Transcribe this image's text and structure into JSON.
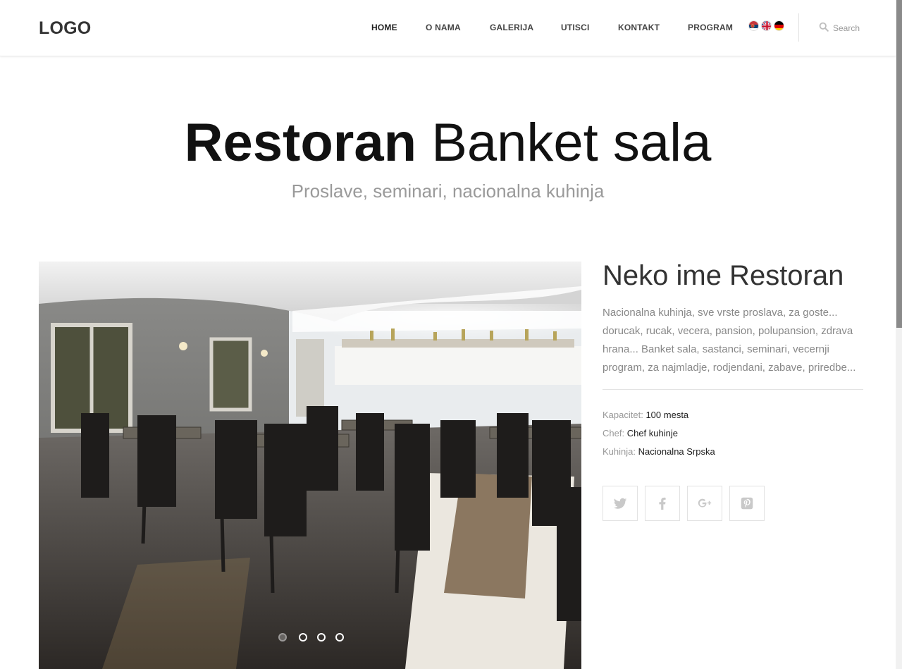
{
  "header": {
    "logo": "LOGO",
    "nav": [
      {
        "label": "HOME",
        "active": true
      },
      {
        "label": "O NAMA",
        "active": false
      },
      {
        "label": "GALERIJA",
        "active": false
      },
      {
        "label": "UTISCI",
        "active": false
      },
      {
        "label": "KONTAKT",
        "active": false
      },
      {
        "label": "PROGRAM",
        "active": false
      }
    ],
    "languages": [
      "serbian-flag-icon",
      "uk-flag-icon",
      "german-flag-icon"
    ],
    "search": {
      "placeholder": "Search",
      "value": ""
    }
  },
  "hero": {
    "title_bold": "Restoran",
    "title_light": "Banket sala",
    "subtitle": "Proslave, seminari, nacionalna kuhinja"
  },
  "slider": {
    "image": "restaurant-interior-photo",
    "slide_count": 4,
    "active_slide": 1
  },
  "details": {
    "title": "Neko ime Restoran",
    "description": "Nacionalna kuhinja, sve vrste proslava, za goste... dorucak, rucak, vecera, pansion, polupansion, zdrava hrana... Banket sala, sastanci, seminari, vecernji program, za najmladje, rodjendani, zabave, priredbe...",
    "meta": [
      {
        "label": "Kapacitet:",
        "value": "100 mesta"
      },
      {
        "label": "Chef:",
        "value": "Chef kuhinje"
      },
      {
        "label": "Kuhinja:",
        "value": "Nacionalna Srpska"
      }
    ],
    "social": [
      "twitter-icon",
      "facebook-icon",
      "google-plus-icon",
      "pinterest-icon"
    ]
  },
  "colors": {
    "text_dark": "#111111",
    "text_muted": "#9a9a9a",
    "border": "#e2e2e2"
  }
}
